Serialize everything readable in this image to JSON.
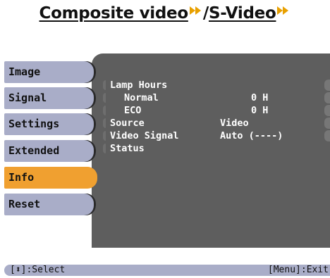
{
  "heading": {
    "part1": "Composite video",
    "separator": "/",
    "part2": "S-Video",
    "arrow_icon": "double-right-arrow-icon",
    "arrow_color": "#e8a000"
  },
  "menu": {
    "tabs": [
      {
        "label": "Image"
      },
      {
        "label": "Signal"
      },
      {
        "label": "Settings"
      },
      {
        "label": "Extended"
      },
      {
        "label": "Info",
        "active": true
      },
      {
        "label": "Reset"
      }
    ],
    "active_color": "#f0a030",
    "tab_color": "#a9adc8",
    "panel_color": "#5e5e5e"
  },
  "info": {
    "lamp_hours": "Lamp Hours",
    "normal_label": "Normal",
    "normal_value": "0 H",
    "eco_label": "ECO",
    "eco_value": "0 H",
    "source_label": "Source",
    "source_value": "Video",
    "video_signal_label": "Video Signal",
    "video_signal_value": "Auto (----)",
    "status_label": "Status"
  },
  "footer": {
    "select_hint": "[⬍]:Select",
    "exit_hint": "[Menu]:Exit"
  }
}
